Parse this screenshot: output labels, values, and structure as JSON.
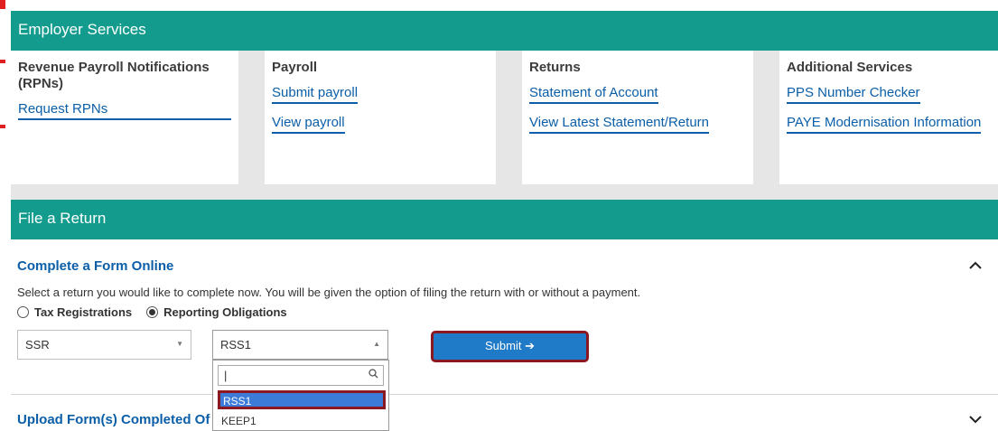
{
  "employer_services": {
    "header": "Employer Services",
    "cards": {
      "rpn": {
        "title": "Revenue Payroll Notifications (RPNs)",
        "links": [
          "Request RPNs"
        ]
      },
      "payroll": {
        "title": "Payroll",
        "links": [
          "Submit payroll",
          "View payroll"
        ]
      },
      "returns": {
        "title": "Returns",
        "links": [
          "Statement of Account",
          "View Latest Statement/Return"
        ]
      },
      "additional": {
        "title": "Additional Services",
        "links": [
          "PPS Number Checker",
          "PAYE Modernisation Information"
        ]
      }
    }
  },
  "file_return": {
    "header": "File a Return",
    "complete_form": {
      "title": "Complete a Form Online",
      "instruction": "Select a return you would like to complete now. You will be given the option of filing the return with or without a payment.",
      "radios": [
        {
          "label": "Tax Registrations",
          "checked": false
        },
        {
          "label": "Reporting Obligations",
          "checked": true
        }
      ],
      "type_select_value": "SSR",
      "form_select_value": "RSS1",
      "submit_label": "Submit ➔",
      "dropdown": {
        "search_value": "|",
        "options": [
          "RSS1",
          "KEEP1"
        ]
      }
    },
    "upload_form": {
      "title": "Upload Form(s) Completed Of"
    }
  },
  "colors": {
    "teal": "#139b8e",
    "link_blue": "#0b5ea8",
    "button_blue": "#1f7ac8",
    "highlight_red": "#8b1820"
  },
  "icons": {
    "collapse": "chevron-up-icon",
    "expand": "chevron-down-icon",
    "search": "search-icon",
    "select_arrow": "caret-down-icon"
  }
}
